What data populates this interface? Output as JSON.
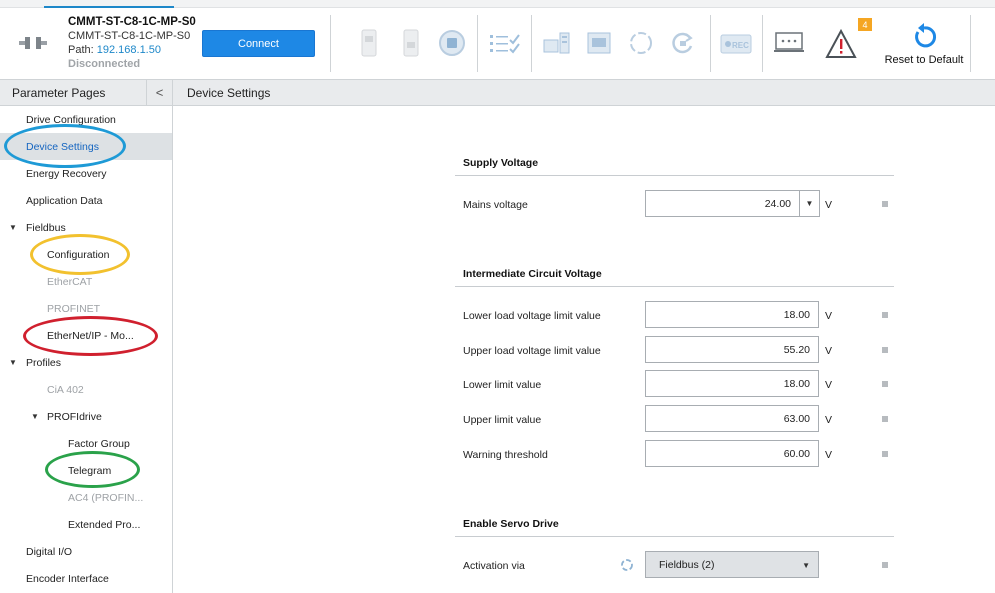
{
  "device": {
    "name": "CMMT-ST-C8-1C-MP-S0",
    "subname": "CMMT-ST-C8-1C-MP-S0",
    "path_label": "Path:",
    "path_value": "192.168.1.50",
    "status": "Disconnected"
  },
  "toolbar": {
    "connect_label": "Connect",
    "warning_count": "4",
    "reset_label": "Reset to Default",
    "icons": [
      "device-plug-icon",
      "stop-icon",
      "stop-icon",
      "stop-circle-icon",
      "checklist-icon",
      "network-download-icon",
      "save-to-device-icon",
      "refresh-icon",
      "restore-icon",
      "record-icon",
      "monitor-icon",
      "warning-icon",
      "reset-arrow-icon"
    ],
    "accent_color": "#1e88c9"
  },
  "left_panel": {
    "title": "Parameter Pages",
    "collapse_glyph": "<",
    "items": [
      {
        "label": "Drive Configuration",
        "state": "normal"
      },
      {
        "label": "Device Settings",
        "state": "selected"
      },
      {
        "label": "Energy Recovery",
        "state": "normal"
      },
      {
        "label": "Application Data",
        "state": "normal"
      },
      {
        "label": "Fieldbus",
        "state": "expanded"
      },
      {
        "label": "Configuration",
        "state": "normal"
      },
      {
        "label": "EtherCAT",
        "state": "disabled"
      },
      {
        "label": "PROFINET",
        "state": "disabled"
      },
      {
        "label": "EtherNet/IP - Mo...",
        "state": "normal"
      },
      {
        "label": "Profiles",
        "state": "expanded"
      },
      {
        "label": "CiA 402",
        "state": "disabled"
      },
      {
        "label": "PROFIdrive",
        "state": "expanded"
      },
      {
        "label": "Factor Group",
        "state": "normal"
      },
      {
        "label": "Telegram",
        "state": "normal"
      },
      {
        "label": "AC4 (PROFIN...",
        "state": "disabled"
      },
      {
        "label": "Extended Pro...",
        "state": "normal"
      },
      {
        "label": "Digital I/O",
        "state": "normal"
      },
      {
        "label": "Encoder Interface",
        "state": "normal"
      }
    ]
  },
  "annotations": {
    "blue": "#1e9ad6",
    "yellow": "#f2c12e",
    "red": "#d0202e",
    "green": "#2aa24a"
  },
  "content": {
    "title": "Device Settings",
    "supply_voltage": {
      "title": "Supply Voltage",
      "mains_label": "Mains voltage",
      "mains_value": "24.00",
      "mains_unit": "V"
    },
    "intermediate": {
      "title": "Intermediate Circuit Voltage",
      "rows": [
        {
          "label": "Lower load voltage limit value",
          "value": "18.00",
          "unit": "V"
        },
        {
          "label": "Upper load voltage limit value",
          "value": "55.20",
          "unit": "V"
        },
        {
          "label": "Lower limit value",
          "value": "18.00",
          "unit": "V"
        },
        {
          "label": "Upper limit value",
          "value": "63.00",
          "unit": "V"
        },
        {
          "label": "Warning threshold",
          "value": "60.00",
          "unit": "V"
        }
      ]
    },
    "servo": {
      "title": "Enable Servo Drive",
      "activation_label": "Activation via",
      "activation_value": "Fieldbus (2)"
    }
  }
}
